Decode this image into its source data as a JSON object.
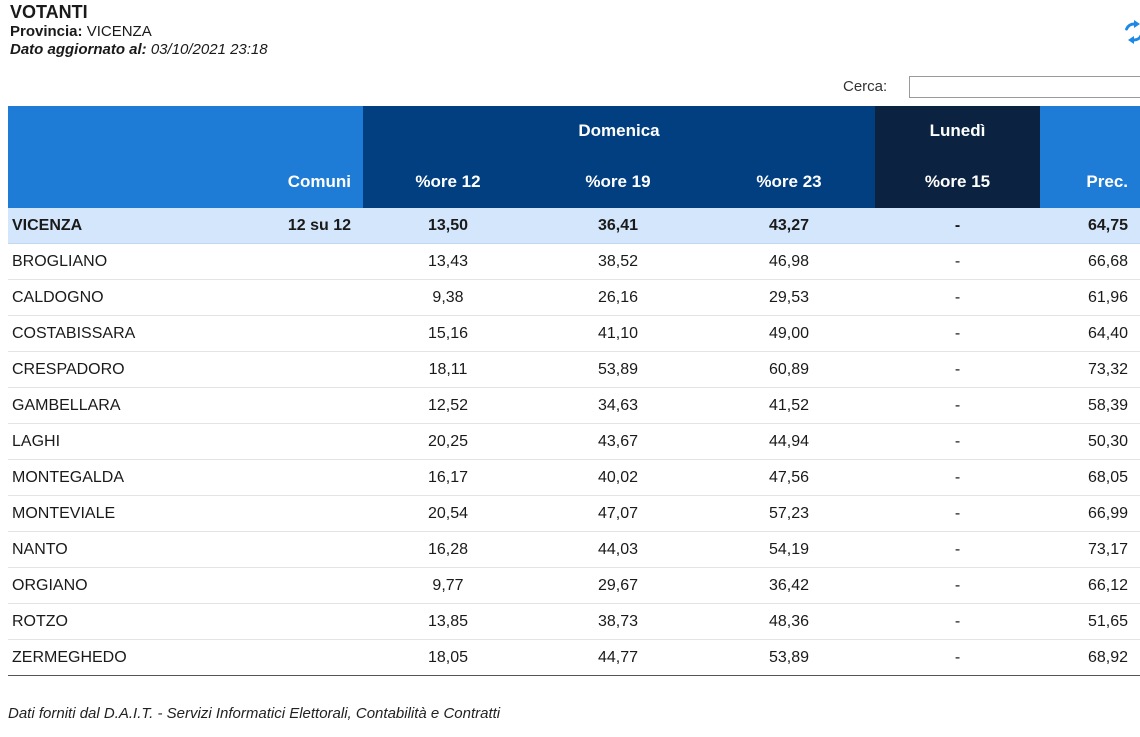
{
  "header": {
    "title": "VOTANTI",
    "province_label": "Provincia:",
    "province_value": " VICENZA",
    "updated_label": "Dato aggiornato al:",
    "updated_value": " 03/10/2021 23:18"
  },
  "search": {
    "label": "Cerca:",
    "value": ""
  },
  "table": {
    "group_headers": {
      "domenica": "Domenica",
      "lunedi": "Lunedì"
    },
    "columns": [
      "",
      "Comuni",
      "%ore 12",
      "%ore 19",
      "%ore 23",
      "%ore 15",
      "Prec."
    ],
    "total_row": {
      "name": "VICENZA",
      "comuni": "12 su 12",
      "ore12": "13,50",
      "ore19": "36,41",
      "ore23": "43,27",
      "ore15": "-",
      "prec": "64,75"
    },
    "rows": [
      {
        "name": "BROGLIANO",
        "ore12": "13,43",
        "ore19": "38,52",
        "ore23": "46,98",
        "ore15": "-",
        "prec": "66,68"
      },
      {
        "name": "CALDOGNO",
        "ore12": "9,38",
        "ore19": "26,16",
        "ore23": "29,53",
        "ore15": "-",
        "prec": "61,96"
      },
      {
        "name": "COSTABISSARA",
        "ore12": "15,16",
        "ore19": "41,10",
        "ore23": "49,00",
        "ore15": "-",
        "prec": "64,40"
      },
      {
        "name": "CRESPADORO",
        "ore12": "18,11",
        "ore19": "53,89",
        "ore23": "60,89",
        "ore15": "-",
        "prec": "73,32"
      },
      {
        "name": "GAMBELLARA",
        "ore12": "12,52",
        "ore19": "34,63",
        "ore23": "41,52",
        "ore15": "-",
        "prec": "58,39"
      },
      {
        "name": "LAGHI",
        "ore12": "20,25",
        "ore19": "43,67",
        "ore23": "44,94",
        "ore15": "-",
        "prec": "50,30"
      },
      {
        "name": "MONTEGALDA",
        "ore12": "16,17",
        "ore19": "40,02",
        "ore23": "47,56",
        "ore15": "-",
        "prec": "68,05"
      },
      {
        "name": "MONTEVIALE",
        "ore12": "20,54",
        "ore19": "47,07",
        "ore23": "57,23",
        "ore15": "-",
        "prec": "66,99"
      },
      {
        "name": "NANTO",
        "ore12": "16,28",
        "ore19": "44,03",
        "ore23": "54,19",
        "ore15": "-",
        "prec": "73,17"
      },
      {
        "name": "ORGIANO",
        "ore12": "9,77",
        "ore19": "29,67",
        "ore23": "36,42",
        "ore15": "-",
        "prec": "66,12"
      },
      {
        "name": "ROTZO",
        "ore12": "13,85",
        "ore19": "38,73",
        "ore23": "48,36",
        "ore15": "-",
        "prec": "51,65"
      },
      {
        "name": "ZERMEGHEDO",
        "ore12": "18,05",
        "ore19": "44,77",
        "ore23": "53,89",
        "ore15": "-",
        "prec": "68,92"
      }
    ]
  },
  "footer": "Dati forniti dal D.A.I.T. - Servizi Informatici Elettorali, Contabilità e Contratti",
  "colors": {
    "header_blue": "#1e7bd6",
    "header_dark_blue": "#023f80",
    "header_navy": "#0b2341",
    "total_row": "#d3e6fb",
    "refresh_icon": "#1e88e5"
  },
  "icons": {
    "refresh": "refresh-icon"
  }
}
